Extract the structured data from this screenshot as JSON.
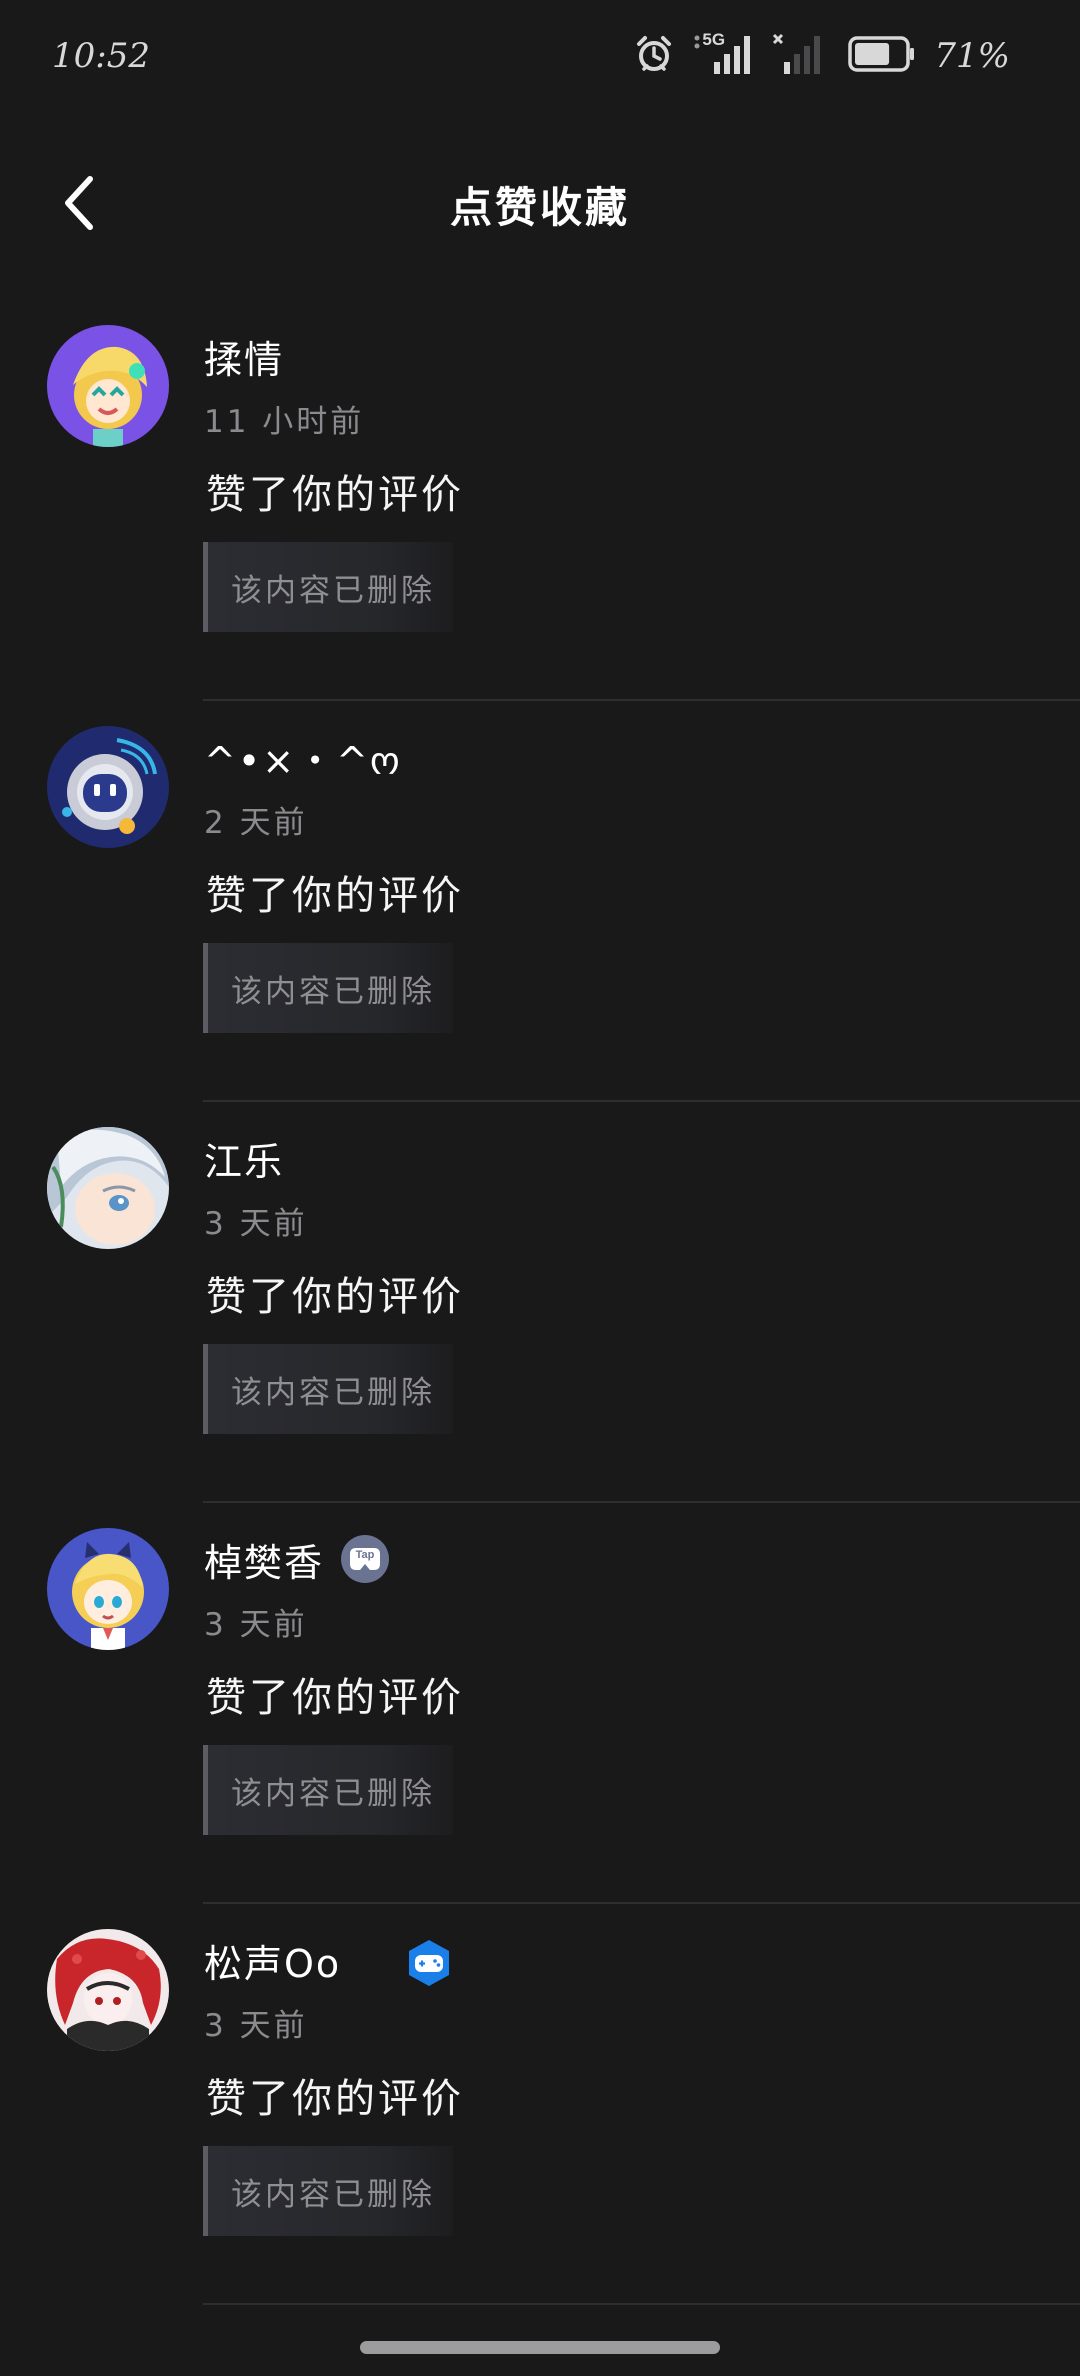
{
  "status_bar": {
    "time": "10:52",
    "network": "5G",
    "battery_percent": "71%",
    "battery_level": 0.71,
    "icons": [
      "alarm-icon",
      "signal-5g-icon",
      "signal-sim2-icon",
      "battery-icon"
    ]
  },
  "header": {
    "title": "点赞收藏",
    "back_icon": "chevron-left-icon"
  },
  "notifications": [
    {
      "name": "揉情",
      "time": "11 小时前",
      "action": "赞了你的评价",
      "content": "该内容已删除",
      "badge": null
    },
    {
      "name": "^•×・^ო",
      "time": "2 天前",
      "action": "赞了你的评价",
      "content": "该内容已删除",
      "badge": null
    },
    {
      "name": "江乐",
      "time": "3 天前",
      "action": "赞了你的评价",
      "content": "该内容已删除",
      "badge": null
    },
    {
      "name": "棹樊香",
      "time": "3 天前",
      "action": "赞了你的评价",
      "content": "该内容已删除",
      "badge": "tap-badge-icon",
      "badge_label": "Tap"
    },
    {
      "name": "松声Oo",
      "time": "3 天前",
      "action": "赞了你的评价",
      "content": "该内容已删除",
      "badge": "gamepad-badge-icon"
    }
  ],
  "colors": {
    "background": "#19191a",
    "text_primary": "#ffffff",
    "text_secondary": "#8b8b8f",
    "quote_background": "#2c2d33",
    "badge_blue": "#1a7fe8",
    "badge_gray": "#6a7391"
  }
}
